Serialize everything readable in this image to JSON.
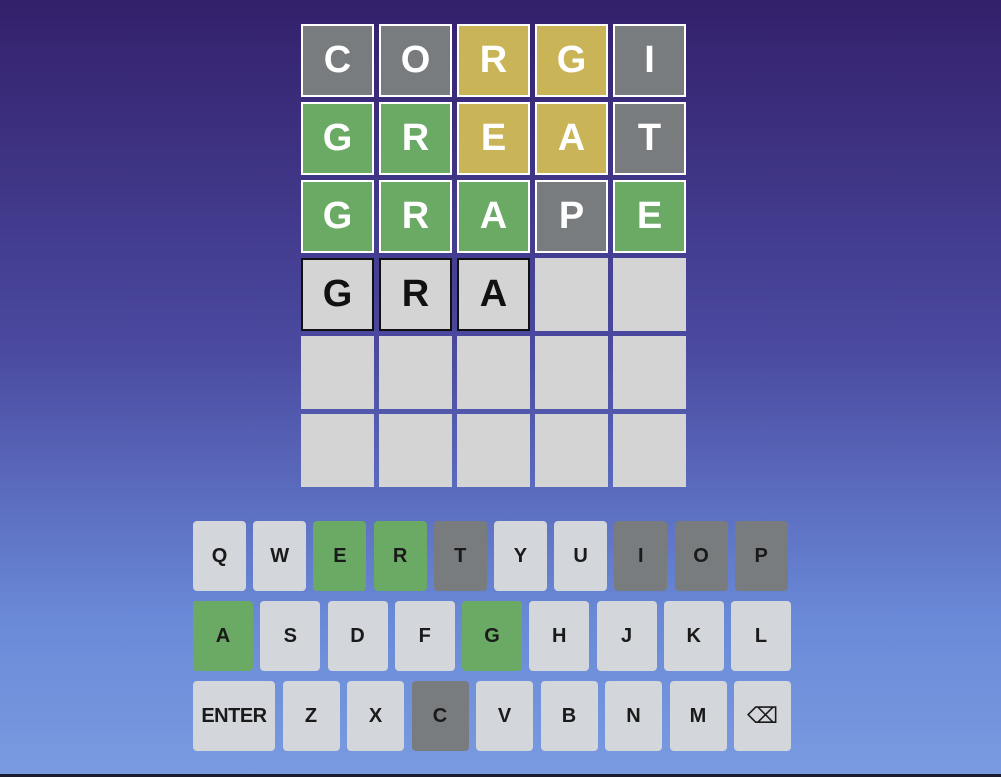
{
  "colors": {
    "correct": "#6aaa64",
    "present": "#c9b458",
    "absent": "#787c7e",
    "empty": "#d4d4d4",
    "key_default": "#d3d6da"
  },
  "board": {
    "rows": [
      {
        "tiles": [
          {
            "letter": "C",
            "state": "absent"
          },
          {
            "letter": "O",
            "state": "absent"
          },
          {
            "letter": "R",
            "state": "present"
          },
          {
            "letter": "G",
            "state": "present"
          },
          {
            "letter": "I",
            "state": "absent"
          }
        ]
      },
      {
        "tiles": [
          {
            "letter": "G",
            "state": "correct"
          },
          {
            "letter": "R",
            "state": "correct"
          },
          {
            "letter": "E",
            "state": "present"
          },
          {
            "letter": "A",
            "state": "present"
          },
          {
            "letter": "T",
            "state": "absent"
          }
        ]
      },
      {
        "tiles": [
          {
            "letter": "G",
            "state": "correct"
          },
          {
            "letter": "R",
            "state": "correct"
          },
          {
            "letter": "A",
            "state": "correct"
          },
          {
            "letter": "P",
            "state": "absent"
          },
          {
            "letter": "E",
            "state": "correct"
          }
        ]
      },
      {
        "tiles": [
          {
            "letter": "G",
            "state": "filled"
          },
          {
            "letter": "R",
            "state": "filled"
          },
          {
            "letter": "A",
            "state": "filled"
          },
          {
            "letter": "",
            "state": "empty"
          },
          {
            "letter": "",
            "state": "empty"
          }
        ]
      },
      {
        "tiles": [
          {
            "letter": "",
            "state": "empty"
          },
          {
            "letter": "",
            "state": "empty"
          },
          {
            "letter": "",
            "state": "empty"
          },
          {
            "letter": "",
            "state": "empty"
          },
          {
            "letter": "",
            "state": "empty"
          }
        ]
      },
      {
        "tiles": [
          {
            "letter": "",
            "state": "empty"
          },
          {
            "letter": "",
            "state": "empty"
          },
          {
            "letter": "",
            "state": "empty"
          },
          {
            "letter": "",
            "state": "empty"
          },
          {
            "letter": "",
            "state": "empty"
          }
        ]
      }
    ]
  },
  "keyboard": {
    "rows": [
      {
        "keys": [
          {
            "label": "Q",
            "state": "default"
          },
          {
            "label": "W",
            "state": "default"
          },
          {
            "label": "E",
            "state": "correct"
          },
          {
            "label": "R",
            "state": "correct"
          },
          {
            "label": "T",
            "state": "absent"
          },
          {
            "label": "Y",
            "state": "default"
          },
          {
            "label": "U",
            "state": "default"
          },
          {
            "label": "I",
            "state": "absent"
          },
          {
            "label": "O",
            "state": "absent"
          },
          {
            "label": "P",
            "state": "absent"
          }
        ]
      },
      {
        "keys": [
          {
            "label": "A",
            "state": "correct"
          },
          {
            "label": "S",
            "state": "default"
          },
          {
            "label": "D",
            "state": "default"
          },
          {
            "label": "F",
            "state": "default"
          },
          {
            "label": "G",
            "state": "correct"
          },
          {
            "label": "H",
            "state": "default"
          },
          {
            "label": "J",
            "state": "default"
          },
          {
            "label": "K",
            "state": "default"
          },
          {
            "label": "L",
            "state": "default"
          }
        ]
      },
      {
        "keys": [
          {
            "label": "ENTER",
            "state": "default",
            "name": "enter"
          },
          {
            "label": "Z",
            "state": "default"
          },
          {
            "label": "X",
            "state": "default"
          },
          {
            "label": "C",
            "state": "absent"
          },
          {
            "label": "V",
            "state": "default"
          },
          {
            "label": "B",
            "state": "default"
          },
          {
            "label": "N",
            "state": "default"
          },
          {
            "label": "M",
            "state": "default"
          },
          {
            "label": "⌫",
            "state": "default",
            "name": "backspace",
            "icon": "backspace-icon"
          }
        ]
      }
    ]
  }
}
